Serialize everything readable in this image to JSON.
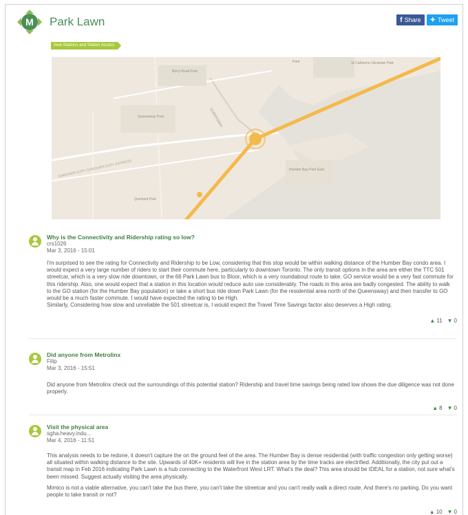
{
  "page": {
    "title": "Park Lawn",
    "tag": "New Stations and Station Access"
  },
  "share": {
    "facebook_label": "Share",
    "twitter_label": "Tweet"
  },
  "map": {
    "labels": {
      "berry_road_park": "Berry Road Park",
      "queensway_park": "Queensway Park",
      "humber_bay_park": "Humber Bay Park East",
      "st_caths": "St Catherine Ukrainian Park",
      "park": "Park",
      "queensway": "QUEENSWAY",
      "gardiner": "GARDINER EXPY GARDINER EXPY EXPRESS",
      "gardiner2": "GARDINER EXPY",
      "quetland_park": "Quetland Park"
    }
  },
  "posts": [
    {
      "title": "Why is the Connectivity and Ridership rating so low?",
      "author": "crs1026",
      "date": "Mar 3, 2016 - 15:01",
      "paragraphs": [
        "I'm surprised to see the rating for Connectivity and Ridership to be Low, considering that this stop would be within walking distance of the Humber Bay condo area. I would expect a very large number of riders to start their commute here, particularly to downtown Toronto. The only transit options in the area are either the TTC 501 streetcar, which is a very slow ride downtown, or the 66 Park Lawn bus to Bloor, which is a very roundabout route to take. GO service would be a very fast commute for this ridership. Also, one would expect that a station in this location would reduce auto use considerably. The roads in this area are badly congested. The ability to walk to the GO station (for the Humber Bay population) or take a short bus ride down Park Lawn (for the residential area north of the Queensway) and then transfer to GO would be a much faster commute. I would have expected the rating to be High.\nSimilarly, Considering how slow and unreliable the 501 streetcar is, I would expect the Travel Time Savings factor also deserves a High rating."
      ],
      "up": "11",
      "down": "0"
    },
    {
      "title": "Did anyone from Metrolinx",
      "author": "Filip",
      "date": "Mar 3, 2016 - 15:51",
      "paragraphs": [
        "Did anyone from Metrolinx check out the surroundings of this potential station? Ridership and travel time savings being rated low shows the due diligence was not done properly."
      ],
      "up": "8",
      "down": "0"
    },
    {
      "title": "Visit the physical area",
      "author": "sgha.heavy.indu...",
      "date": "Mar 4, 2016 - 11:51",
      "paragraphs": [
        "This analysis needs to be redone, it doesn't capture the on the ground feel of the area. The Humber Bay is dense residential (with traffic congestion only getting worse) all situated within walking distance to the site. Upwards of 40K+ residents will live in the station area by the time tracks are electrified. Additionally, the city put out a transit map in Feb 2016 indicating Park Lawn is a hub connecting to the Waterfront West LRT. What's the deal? This area should be IDEAL for a station, not sure what's been missed. Suggest actually visiting the area physically.",
        "Mimico is not a viable alternative, you can't take the bus there, you can't take the streetcar and you can't really walk a direct route. And there's no parking. Do you want people to take transit or not?"
      ],
      "up": "10",
      "down": "0"
    }
  ],
  "colors": {
    "brand_green": "#4b8f56",
    "tag_green": "#a8c83c",
    "route_yellow": "#f5b94a",
    "map_land": "#eee8df",
    "map_water": "#e5e2dc"
  }
}
